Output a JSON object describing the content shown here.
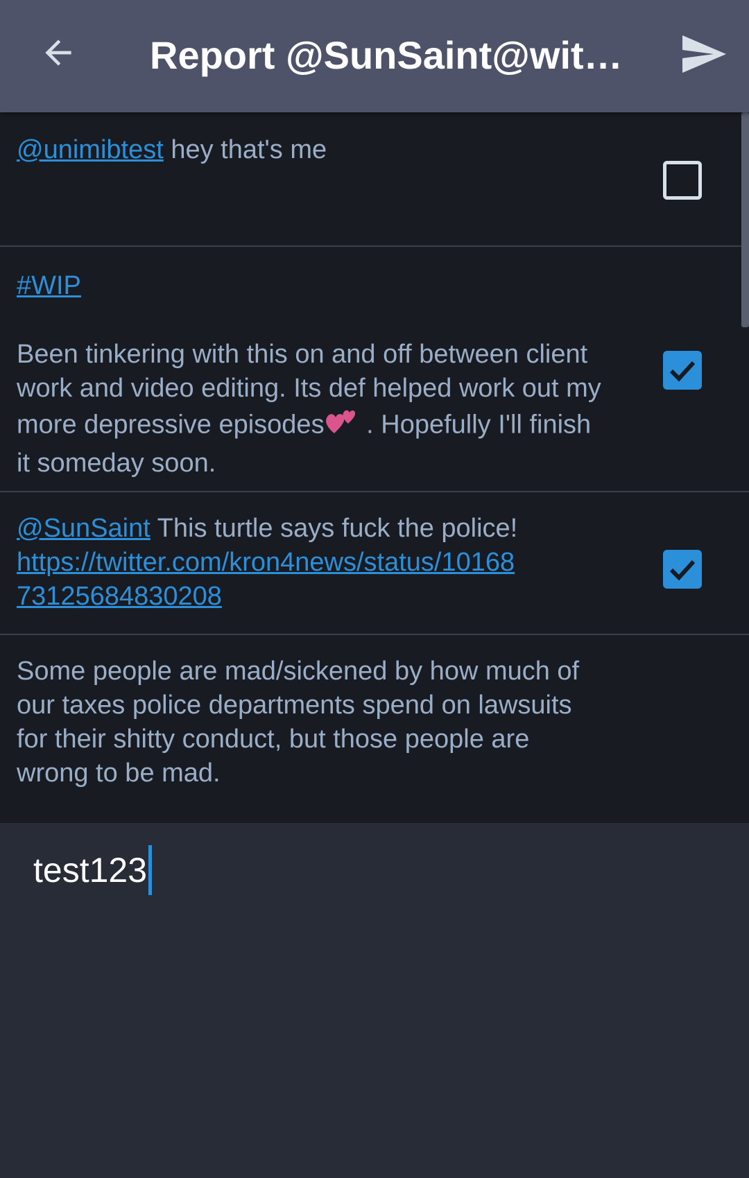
{
  "toolbar": {
    "title": "Report @SunSaint@witc…",
    "back_icon": "arrow-left-icon",
    "send_icon": "send-icon"
  },
  "statuses": [
    {
      "mention": "@unimibtest",
      "text": " hey that's me",
      "checked": false
    },
    {
      "hashtag": "#WIP",
      "text_before_emoji": "Been tinkering with this on and off between client work and video editing. Its def helped work out my more depressive episodes",
      "emoji": "two-hearts-emoji",
      "text_after_emoji": " . Hopefully I'll finish it someday soon.",
      "checked": true
    },
    {
      "mention": "@SunSaint",
      "text": " This turtle says fuck the police!",
      "link": "https://twitter.com/kron4news/status/1016873125684830208",
      "checked": true
    },
    {
      "text": "Some people are mad/sickened by how much of our taxes police departments spend on lawsuits for their shitty conduct, but those people are wrong to be mad."
    }
  ],
  "comment": {
    "value": "test123"
  },
  "colors": {
    "toolbar": "#4e5369",
    "list_background": "#191b22",
    "text": "#9baec8",
    "link": "#2b90d9",
    "checkbox_checked": "#2b90d9",
    "comment_background": "#282c37"
  }
}
